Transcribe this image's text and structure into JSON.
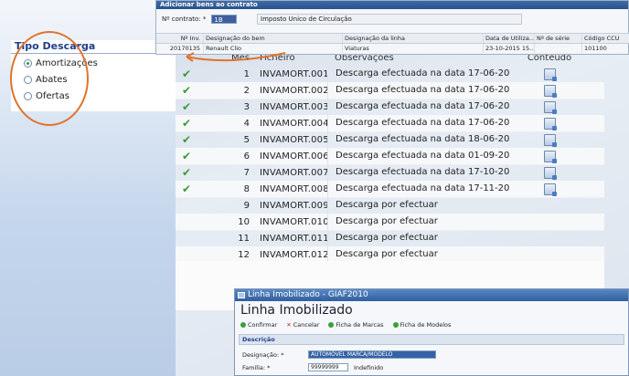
{
  "contract": {
    "title": "Adicionar bens ao contrato",
    "number_label": "Nº contrato: *",
    "number_value": "1B",
    "description": "Imposto Unico de Circulação",
    "columns": [
      "Nº Inv.",
      "Designação do bem",
      "Designação da linha",
      "Data de Utiliza...",
      "Nº de série",
      "Código CCU"
    ],
    "rows": [
      [
        "20170135",
        "Renault Clio",
        "Viaturas",
        "23-10-2015 15...",
        "",
        "101100"
      ]
    ]
  },
  "tipo_descarga": {
    "title": "Tipo Descarga",
    "options": [
      {
        "label": "Amortizações",
        "selected": true
      },
      {
        "label": "Abates",
        "selected": false
      },
      {
        "label": "Ofertas",
        "selected": false
      }
    ]
  },
  "grid": {
    "headers": {
      "mes": "Mês",
      "ficheiro": "Ficheiro",
      "observacoes": "Observações",
      "conteudo": "Conteúdo"
    },
    "rows": [
      {
        "check": "✔",
        "mes": "1",
        "ficheiro": "INVAMORT.001",
        "obs": "Descarga efectuada na data 17-06-20",
        "has_doc": true
      },
      {
        "check": "✔",
        "mes": "2",
        "ficheiro": "INVAMORT.002",
        "obs": "Descarga efectuada na data 17-06-20",
        "has_doc": true
      },
      {
        "check": "✔",
        "mes": "3",
        "ficheiro": "INVAMORT.003",
        "obs": "Descarga efectuada na data 17-06-20",
        "has_doc": true
      },
      {
        "check": "✔",
        "mes": "4",
        "ficheiro": "INVAMORT.004",
        "obs": "Descarga efectuada na data 17-06-20",
        "has_doc": true
      },
      {
        "check": "✔",
        "mes": "5",
        "ficheiro": "INVAMORT.005",
        "obs": "Descarga efectuada na data 18-06-20",
        "has_doc": true
      },
      {
        "check": "✔",
        "mes": "6",
        "ficheiro": "INVAMORT.006",
        "obs": "Descarga efectuada na data 01-09-20",
        "has_doc": true
      },
      {
        "check": "✔",
        "mes": "7",
        "ficheiro": "INVAMORT.007",
        "obs": "Descarga efectuada na data 17-10-20",
        "has_doc": true
      },
      {
        "check": "✔",
        "mes": "8",
        "ficheiro": "INVAMORT.008",
        "obs": "Descarga efectuada na data 17-11-20",
        "has_doc": true
      },
      {
        "check": "",
        "mes": "9",
        "ficheiro": "INVAMORT.009",
        "obs": "Descarga por efectuar",
        "has_doc": false
      },
      {
        "check": "",
        "mes": "10",
        "ficheiro": "INVAMORT.010",
        "obs": "Descarga por efectuar",
        "has_doc": false
      },
      {
        "check": "",
        "mes": "11",
        "ficheiro": "INVAMORT.011",
        "obs": "Descarga por efectuar",
        "has_doc": false
      },
      {
        "check": "",
        "mes": "12",
        "ficheiro": "INVAMORT.012",
        "obs": "Descarga por efectuar",
        "has_doc": false
      }
    ]
  },
  "linha_window": {
    "title": "Linha Imobilizado - GIAF2010",
    "heading": "Linha Imobilizado",
    "toolbar": {
      "confirm": "Confirmar",
      "cancel": "Cancelar",
      "ficha_marcas": "Ficha de Marcas",
      "ficha_modelos": "Ficha de Modelos"
    },
    "section": "Descrição",
    "designacao_label": "Designação: *",
    "designacao_value": "AUTOMÓVEL MARCA/MODELO",
    "familia_label": "Família: *",
    "familia_value": "99999999",
    "familia_desc": "Indefinido"
  },
  "colors": {
    "accent": "#e0732b",
    "check": "#3a9b3a",
    "title_blue": "#1f3f8a"
  }
}
